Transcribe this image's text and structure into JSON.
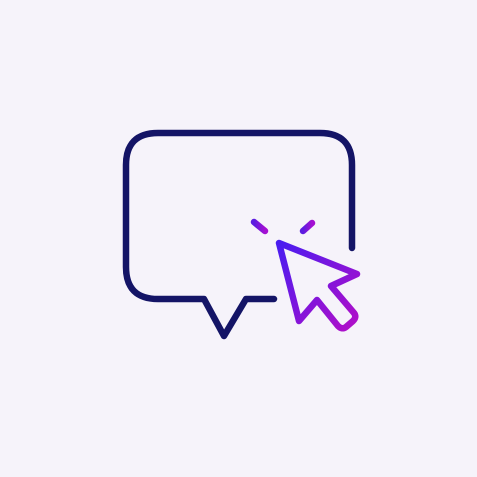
{
  "colors": {
    "background": "#f6f3fa",
    "bubble_stroke": "#141466",
    "cursor_gradient_start": "#4a1cf0",
    "cursor_gradient_end": "#b20fc8",
    "spark_gradient_start": "#5a1ce0",
    "spark_gradient_end": "#a50fd2"
  },
  "icons": {
    "main": "chat-bubble-with-click-cursor-icon",
    "bubble": "speech-bubble-icon",
    "cursor": "mouse-pointer-cursor-icon",
    "click": "click-burst-icon"
  }
}
